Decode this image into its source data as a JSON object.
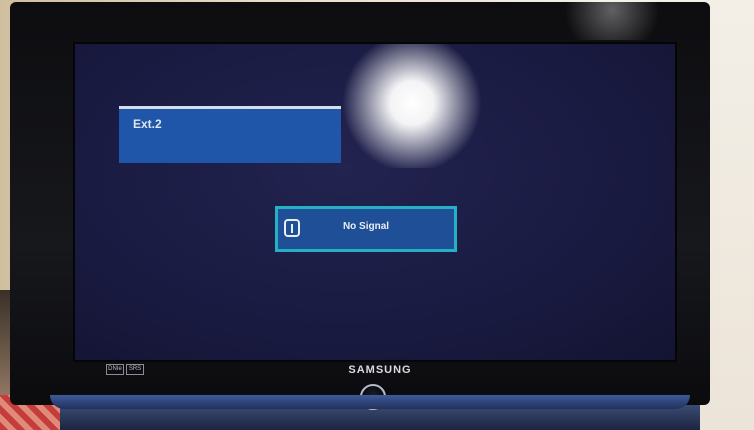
{
  "osd": {
    "source_label": "Ext.2",
    "no_signal_text": "No Signal"
  },
  "tv": {
    "brand": "SAMSUNG",
    "badge_left": "DNIe",
    "badge_right": "SRS"
  },
  "colors": {
    "screen_bg": "#1a1b42",
    "osd_blue": "#1f56a9",
    "osd_border": "#23b1c3",
    "bezel": "#0d0d10"
  },
  "icons": {
    "no_signal": "info-icon",
    "power": "power-icon"
  }
}
